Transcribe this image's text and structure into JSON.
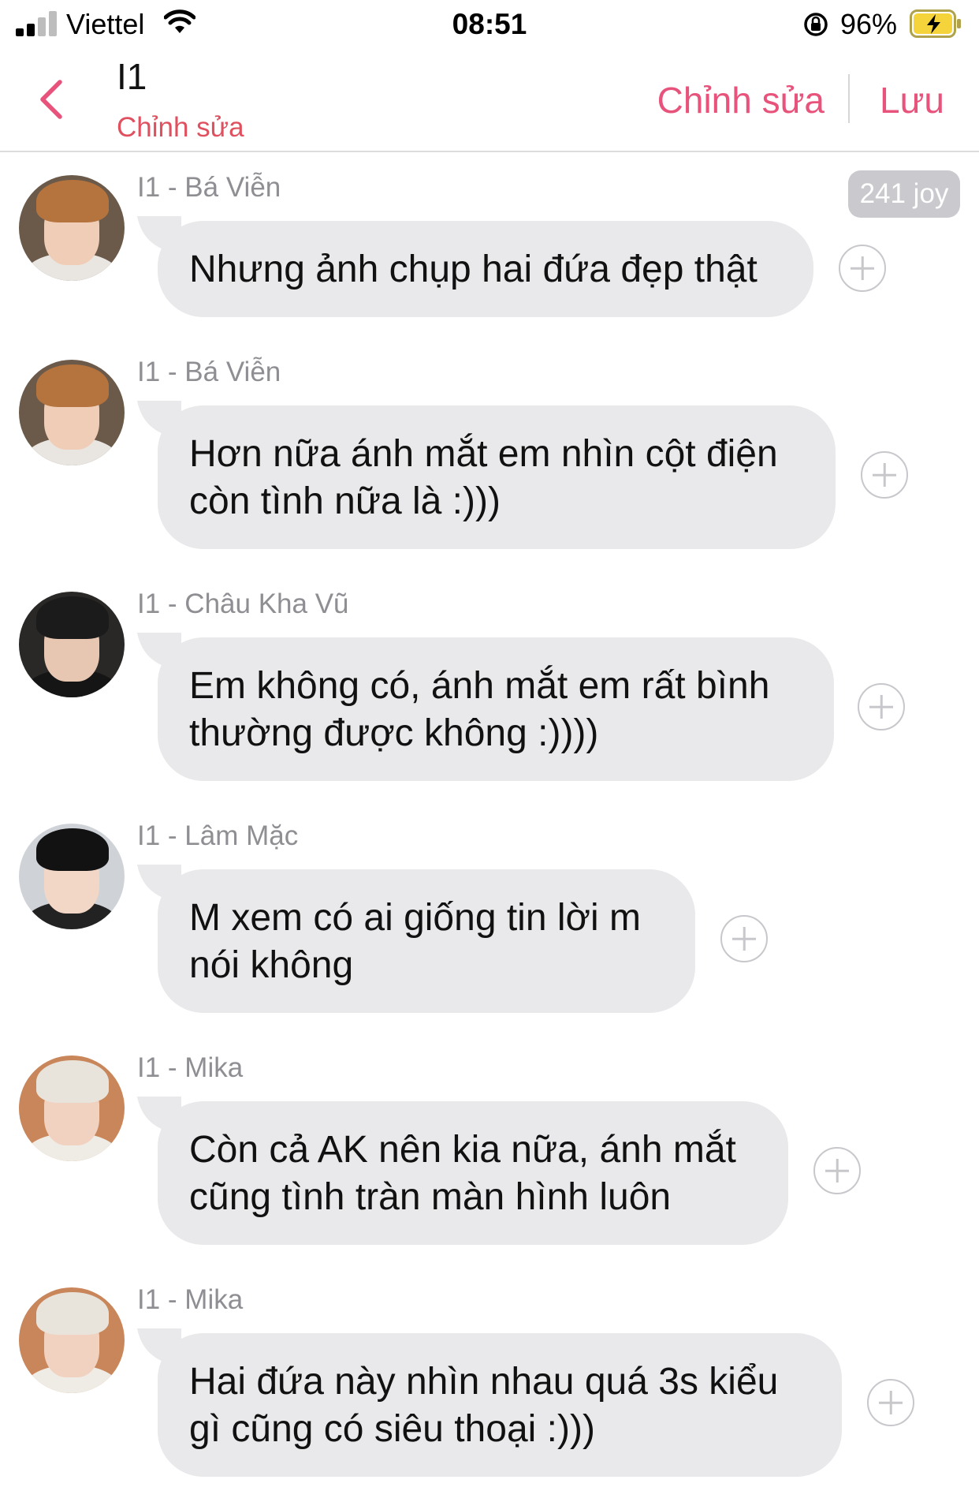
{
  "status_bar": {
    "carrier": "Viettel",
    "time": "08:51",
    "battery_percent": "96%"
  },
  "nav": {
    "title": "I1",
    "subtitle": "Chỉnh sửa",
    "edit_label": "Chỉnh sửa",
    "save_label": "Lưu"
  },
  "joy_badge": "241 joy",
  "messages": [
    {
      "sender": "I1 -  Bá Viễn",
      "text": "Nhưng ảnh chụp hai đứa đẹp thật"
    },
    {
      "sender": "I1 -  Bá Viễn",
      "text": "Hơn nữa ánh mắt em nhìn cột điện còn tình nữa là :)))"
    },
    {
      "sender": "I1 - Châu Kha Vũ",
      "text": "Em không có, ánh mắt em rất bình thường được không :))))"
    },
    {
      "sender": "I1 - Lâm Mặc",
      "text": "M xem có ai giống tin lời m nói không"
    },
    {
      "sender": "I1 - Mika",
      "text": "Còn cả AK nên kia nữa, ánh mắt cũng tình tràn màn hình luôn"
    },
    {
      "sender": "I1 - Mika",
      "text": "Hai đứa này nhìn nhau quá 3s  kiểu gì cũng có siêu thoại :)))"
    }
  ],
  "colors": {
    "accent": "#e8537c",
    "subtitle": "#e05160",
    "bubble": "#e9e9eb",
    "sender": "#8e8e93"
  }
}
